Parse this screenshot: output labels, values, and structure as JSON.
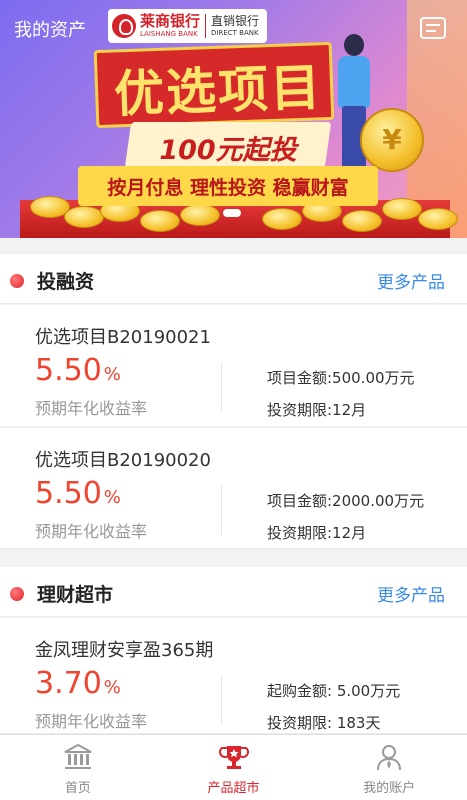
{
  "header": {
    "title": "我的资产",
    "bank_name": "莱商银行",
    "bank_name_en": "LAISHANG BANK",
    "direct_bank": "直销银行",
    "direct_bank_en": "DIRECT BANK"
  },
  "banner": {
    "headline": "优选项目",
    "subline": "100元起投",
    "slogan": "按月付息 理性投资 稳赢财富",
    "coin_symbol": "¥",
    "page_count": 1,
    "active_page": 1
  },
  "sections": [
    {
      "title": "投融资",
      "more_label": "更多产品",
      "products": [
        {
          "name": "优选项目B20190021",
          "rate": "5.50",
          "rate_unit": "%",
          "rate_label": "预期年化收益率",
          "info1": "项目金额:500.00万元",
          "info2": "投资期限:12月"
        },
        {
          "name": "优选项目B20190020",
          "rate": "5.50",
          "rate_unit": "%",
          "rate_label": "预期年化收益率",
          "info1": "项目金额:2000.00万元",
          "info2": "投资期限:12月"
        }
      ]
    },
    {
      "title": "理财超市",
      "more_label": "更多产品",
      "products": [
        {
          "name": "金凤理财安享盈365期",
          "rate": "3.70",
          "rate_unit": "%",
          "rate_label": "预期年化收益率",
          "info1": "起购金额: 5.00万元",
          "info2": "投资期限: 183天"
        }
      ]
    }
  ],
  "tabbar": {
    "tabs": [
      {
        "label": "首页",
        "icon": "bank-building-icon",
        "active": false
      },
      {
        "label": "产品超市",
        "icon": "trophy-icon",
        "active": true
      },
      {
        "label": "我的账户",
        "icon": "user-profile-icon",
        "active": false
      }
    ]
  },
  "colors": {
    "accent_red": "#d8262c",
    "rate_red": "#f0442f",
    "link_blue": "#3a8ae8",
    "tab_inactive": "#888888"
  }
}
